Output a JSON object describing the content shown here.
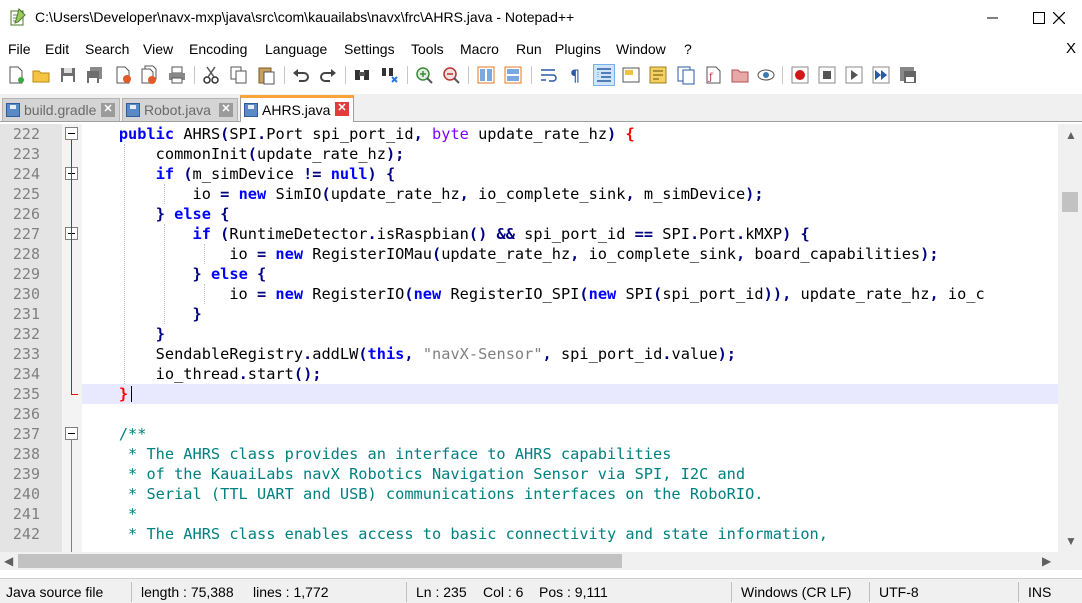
{
  "window": {
    "title": "C:\\Users\\Developer\\navx-mxp\\java\\src\\com\\kauailabs\\navx\\frc\\AHRS.java - Notepad++",
    "minimize": "—",
    "maximize": "☐",
    "close": "✕"
  },
  "menu": {
    "items": [
      "File",
      "Edit",
      "Search",
      "View",
      "Encoding",
      "Language",
      "Settings",
      "Tools",
      "Macro",
      "Run",
      "Plugins",
      "Window",
      "?"
    ],
    "close_doc": "X"
  },
  "toolbar": {
    "icons": [
      "new-file",
      "open-file",
      "save",
      "save-all",
      "close",
      "close-all",
      "print",
      "cut",
      "copy",
      "paste",
      "undo",
      "redo",
      "find",
      "replace",
      "zoom-in",
      "zoom-out",
      "sync-vertical",
      "sync-horizontal",
      "word-wrap",
      "show-all-chars",
      "indent-guide",
      "user-defined-language",
      "document-map",
      "function-list",
      "folder-as-workspace",
      "monitoring",
      "record-macro",
      "stop-macro",
      "play-macro",
      "run-macro-multiple",
      "save-macro"
    ]
  },
  "tabs": [
    {
      "label": "build.gradle",
      "active": false
    },
    {
      "label": "Robot.java",
      "active": false
    },
    {
      "label": "AHRS.java",
      "active": true
    }
  ],
  "editor": {
    "lines": [
      {
        "num": "222",
        "code": "    public AHRS(SPI.Port spi_port_id, byte update_rate_hz) {"
      },
      {
        "num": "223",
        "code": "        commonInit(update_rate_hz);"
      },
      {
        "num": "224",
        "code": "        if (m_simDevice != null) {"
      },
      {
        "num": "225",
        "code": "            io = new SimIO(update_rate_hz, io_complete_sink, m_simDevice);"
      },
      {
        "num": "226",
        "code": "        } else {"
      },
      {
        "num": "227",
        "code": "            if (RuntimeDetector.isRaspbian() && spi_port_id == SPI.Port.kMXP) {"
      },
      {
        "num": "228",
        "code": "                io = new RegisterIOMau(update_rate_hz, io_complete_sink, board_capabilities);"
      },
      {
        "num": "229",
        "code": "            } else {"
      },
      {
        "num": "230",
        "code": "                io = new RegisterIO(new RegisterIO_SPI(new SPI(spi_port_id)), update_rate_hz, io_c"
      },
      {
        "num": "231",
        "code": "            }"
      },
      {
        "num": "232",
        "code": "        }"
      },
      {
        "num": "233",
        "code": "        SendableRegistry.addLW(this, \"navX-Sensor\", spi_port_id.value);"
      },
      {
        "num": "234",
        "code": "        io_thread.start();"
      },
      {
        "num": "235",
        "code": "    }"
      },
      {
        "num": "236",
        "code": ""
      },
      {
        "num": "237",
        "code": "    /**"
      },
      {
        "num": "238",
        "code": "     * The AHRS class provides an interface to AHRS capabilities"
      },
      {
        "num": "239",
        "code": "     * of the KauaiLabs navX Robotics Navigation Sensor via SPI, I2C and"
      },
      {
        "num": "240",
        "code": "     * Serial (TTL UART and USB) communications interfaces on the RoboRIO."
      },
      {
        "num": "241",
        "code": "     *"
      },
      {
        "num": "242",
        "code": "     * The AHRS class enables access to basic connectivity and state information,"
      }
    ]
  },
  "status": {
    "file_type": "Java source file",
    "length": "length : 75,388",
    "lines": "lines : 1,772",
    "ln": "Ln : 235",
    "col": "Col : 6",
    "pos": "Pos : 9,111",
    "eol": "Windows (CR LF)",
    "encoding": "UTF-8",
    "mode": "INS"
  }
}
